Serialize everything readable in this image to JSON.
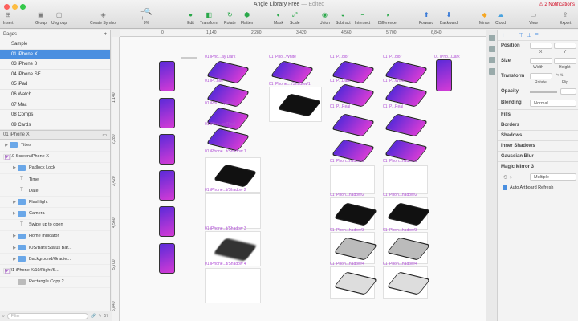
{
  "window": {
    "title": "Angle Library Free",
    "edited": "— Edited",
    "notifications": "2 Notifications"
  },
  "toolbar": {
    "insert": "Insert",
    "group": "Group",
    "ungroup": "Ungroup",
    "create_symbol": "Create Symbol",
    "zoom": "9%",
    "edit": "Edit",
    "transform": "Transform",
    "rotate": "Rotate",
    "flatten": "Flatten",
    "mask": "Mask",
    "scale": "Scale",
    "union": "Union",
    "subtract": "Subtract",
    "intersect": "Intersect",
    "difference": "Difference",
    "forward": "Forward",
    "backward": "Backward",
    "mirror": "Mirror",
    "cloud": "Cloud",
    "view": "View",
    "export": "Export"
  },
  "sidebar": {
    "pages_label": "Pages",
    "pages": [
      "Sample",
      "01 iPhone X",
      "03 iPhone 8",
      "04 iPhone SE",
      "05 iPad",
      "06 Watch",
      "07 Mac",
      "08 Comps",
      "09 Cards"
    ],
    "current_page": "01 iPhone X",
    "layers": [
      {
        "label": "Titles",
        "kind": "folder",
        "indent": 0
      },
      {
        "label": "10 Screen/iPhone X",
        "kind": "artboard",
        "indent": 0
      },
      {
        "label": "Padlock Lock",
        "kind": "folder",
        "indent": 1
      },
      {
        "label": "Time",
        "kind": "text",
        "indent": 1
      },
      {
        "label": "Date",
        "kind": "text",
        "indent": 1
      },
      {
        "label": "Flashlight",
        "kind": "folder",
        "indent": 1
      },
      {
        "label": "Camera",
        "kind": "folder",
        "indent": 1
      },
      {
        "label": "Swipe up to open",
        "kind": "text",
        "indent": 1
      },
      {
        "label": "Home Indicator",
        "kind": "folder",
        "indent": 1
      },
      {
        "label": "iOS/Bars/Status Bar...",
        "kind": "folder",
        "indent": 1
      },
      {
        "label": "Background/Gradie...",
        "kind": "folder",
        "indent": 1
      },
      {
        "label": "01 iPhone X/10/Right/S...",
        "kind": "artboard",
        "indent": 0
      },
      {
        "label": "Rectangle Copy 2",
        "kind": "shape",
        "indent": 1
      }
    ],
    "filter_placeholder": "Filter",
    "layer_count": "57"
  },
  "rulers": {
    "top": [
      "0",
      "1,140",
      "2,280",
      "3,420",
      "4,560",
      "5,700",
      "6,840"
    ],
    "left": [
      "1,140",
      "2,280",
      "3,420",
      "4,560",
      "5,700",
      "6,840"
    ]
  },
  "canvas": {
    "labels": [
      "01 iPho...ay Dark",
      "01 iPho...White",
      "01 iP...olor",
      "01 iP...olor",
      "01 iPho...Dark",
      "01 iPhone...t/Shadow/1",
      "01 iP...Dark",
      "01 iP...White",
      "01 iP...hite",
      "01 iPho...ay/Flat",
      "01 iP...Real",
      "01 iP...Real",
      "01 iPho...ay/Real",
      "01 iPhone...t/Shadow 1",
      "01 iPhon...hadow/1",
      "01 iPhon...hadow/1",
      "01 iPhone...t/Shadow 2",
      "01 iPhon...hadow/2",
      "01 iPhon...hadow/2",
      "01 iPhone...t/Shadow 3",
      "01 iPhon...hadow/3",
      "01 iPhon...hadow/3",
      "01 iPhone...t/Shadow 4",
      "01 iPhon...hadow/4",
      "01 iPhon...hadow/4"
    ]
  },
  "inspector": {
    "position": "Position",
    "x": "X",
    "y": "Y",
    "size": "Size",
    "width": "Width",
    "height": "Height",
    "transform": "Transform",
    "rotate": "Rotate",
    "flip": "Flip",
    "opacity": "Opacity",
    "blending": "Blending",
    "blending_value": "Normal",
    "sections": [
      "Fills",
      "Borders",
      "Shadows",
      "Inner Shadows",
      "Gaussian Blur"
    ],
    "plugin": "Magic Mirror 3",
    "mirror_mode": "Multiple",
    "auto_refresh": "Auto Artboard Refresh"
  },
  "colors": {
    "accent": "#4a8fe0",
    "phone_gradient_start": "#5b2ad8",
    "phone_gradient_end": "#d53bd6",
    "artboard_label": "#b04fd6"
  }
}
